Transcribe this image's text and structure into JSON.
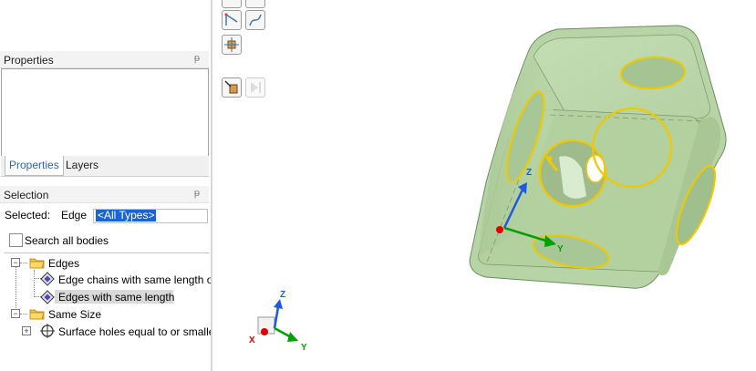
{
  "properties_panel": {
    "title": "Properties",
    "pin": "ᵽ"
  },
  "tabs": [
    {
      "label": "Properties"
    },
    {
      "label": "Layers"
    }
  ],
  "selection_panel": {
    "title": "Selection",
    "pin": "ᵽ",
    "selected_label": "Selected:",
    "selected_value": "Edge",
    "type_combo_value": "<All Types>",
    "search_all_bodies": {
      "label": "Search all bodies",
      "checked": false
    }
  },
  "tree": {
    "edges": {
      "label": "Edges",
      "items": [
        {
          "label": "Edge chains with same length o"
        },
        {
          "label": "Edges with same length"
        }
      ]
    },
    "same_size": {
      "label": "Same Size",
      "items": [
        {
          "label": "Surface holes equal to or smalle"
        }
      ]
    }
  },
  "viewport": {
    "triad_main": {
      "x": "X",
      "y": "Y",
      "z": "Z"
    },
    "triad_corner": {
      "x": "X",
      "y": "Y",
      "z": "Z"
    },
    "colors": {
      "body": "#b7d4a6",
      "highlight": "#f0c800",
      "axis_x": "#e00000",
      "axis_y": "#00a000",
      "axis_z": "#1e5adf"
    }
  }
}
